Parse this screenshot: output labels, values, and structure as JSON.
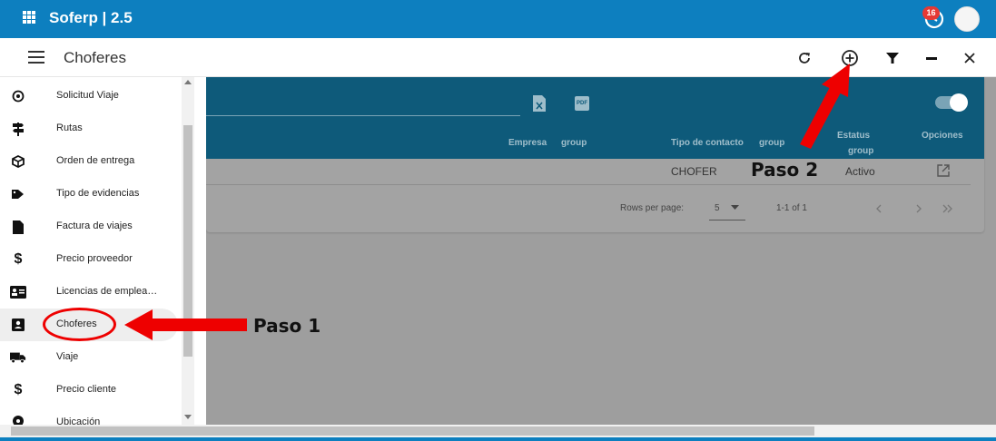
{
  "app": {
    "title": "Soferp | 2.5",
    "notification_count": "16"
  },
  "header": {
    "title": "Choferes"
  },
  "table": {
    "columns": [
      "Empresa",
      "group",
      "Tipo de contacto",
      "group",
      "Estatus",
      "group",
      "Opciones"
    ],
    "rows": [
      {
        "tipo_contacto": "CHOFER",
        "estatus": "Activo"
      }
    ],
    "pagination": {
      "rows_per_page_label": "Rows per page:",
      "rows_per_page": "5",
      "range": "1-1 of 1"
    }
  },
  "sidebar": {
    "items": [
      {
        "label": "Solicitud Viaje",
        "icon": "location-icon"
      },
      {
        "label": "Rutas",
        "icon": "signpost-icon"
      },
      {
        "label": "Orden de entrega",
        "icon": "package-icon"
      },
      {
        "label": "Tipo de evidencias",
        "icon": "tags-icon"
      },
      {
        "label": "Factura de viajes",
        "icon": "file-icon"
      },
      {
        "label": "Precio proveedor",
        "icon": "dollar-icon"
      },
      {
        "label": "Licencias de emplea…",
        "icon": "id-card-icon"
      },
      {
        "label": "Choferes",
        "icon": "contact-icon"
      },
      {
        "label": "Viaje",
        "icon": "truck-icon"
      },
      {
        "label": "Precio cliente",
        "icon": "dollar-icon"
      },
      {
        "label": "Ubicación",
        "icon": "pin-icon"
      }
    ]
  },
  "annotations": {
    "paso1": "Paso 1",
    "paso2": "Paso 2"
  },
  "colors": {
    "topbar": "#0d7fbf",
    "table_header": "#0e5a7a",
    "arrow": "#e00000",
    "overlay": "#9e9e9e"
  }
}
